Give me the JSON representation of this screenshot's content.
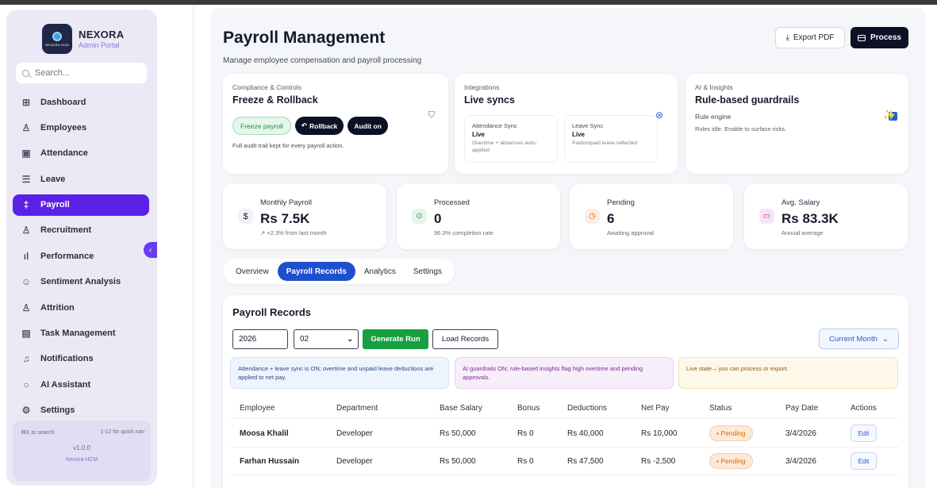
{
  "brand": {
    "name": "NEXORA",
    "subtitle": "Admin Portal",
    "logo_text": "NEXORA HCM"
  },
  "search": {
    "placeholder": "Search..."
  },
  "nav": [
    {
      "label": "Dashboard",
      "icon": "grid-icon"
    },
    {
      "label": "Employees",
      "icon": "user-icon"
    },
    {
      "label": "Attendance",
      "icon": "calendar-icon"
    },
    {
      "label": "Leave",
      "icon": "inbox-icon"
    },
    {
      "label": "Payroll",
      "icon": "dollar-icon",
      "active": true
    },
    {
      "label": "Recruitment",
      "icon": "user-icon"
    },
    {
      "label": "Performance",
      "icon": "bar-chart-icon"
    },
    {
      "label": "Sentiment Analysis",
      "icon": "smile-icon"
    },
    {
      "label": "Attrition",
      "icon": "users-icon"
    },
    {
      "label": "Task Management",
      "icon": "clipboard-icon"
    },
    {
      "label": "Notifications",
      "icon": "bell-icon"
    },
    {
      "label": "AI Assistant",
      "icon": "chat-icon"
    },
    {
      "label": "Settings",
      "icon": "gear-icon"
    }
  ],
  "sidebar_footer": {
    "shortcut_search": "⌘K to search",
    "shortcut_nav": "1-12 for quick nav",
    "version": "v1.0.0",
    "product": "Nexora HCM"
  },
  "header": {
    "title": "Payroll Management",
    "subtitle": "Manage employee compensation and payroll processing",
    "export_label": "Export PDF",
    "process_label": "Process"
  },
  "compliance": {
    "eyebrow": "Compliance & Controls",
    "title": "Freeze & Rollback",
    "freeze_label": "Freeze payroll",
    "rollback_label": "Rollback",
    "audit_label": "Audit on",
    "note": "Full audit trail kept for every payroll action."
  },
  "integrations": {
    "eyebrow": "Integrations",
    "title": "Live syncs",
    "attendance": {
      "title": "Attendance Sync",
      "status": "Live",
      "desc": "Overtime + absences auto-applied"
    },
    "leave": {
      "title": "Leave Sync",
      "status": "Live",
      "desc": "Paid/unpaid leave reflected"
    }
  },
  "ai": {
    "eyebrow": "AI & Insights",
    "title": "Rule-based guardrails",
    "rule_label": "Rule engine",
    "rule_checked": true,
    "note": "Rules idle. Enable to surface risks."
  },
  "stats": [
    {
      "label": "Monthly Payroll",
      "value": "Rs 7.5K",
      "sub": "↗ +2.3% from last month",
      "icon": "dollar-icon"
    },
    {
      "label": "Processed",
      "value": "0",
      "sub": "96.3% completion rate",
      "icon": "check-circle-icon"
    },
    {
      "label": "Pending",
      "value": "6",
      "sub": "Awaiting approval",
      "icon": "clock-icon"
    },
    {
      "label": "Avg. Salary",
      "value": "Rs 83.3K",
      "sub": "Annual average",
      "icon": "card-icon"
    }
  ],
  "tabs": [
    "Overview",
    "Payroll Records",
    "Analytics",
    "Settings"
  ],
  "records": {
    "title": "Payroll Records",
    "year_value": "2026",
    "month_value": "02",
    "generate_label": "Generate Run",
    "load_label": "Load Records",
    "period_label": "Current Month",
    "notes": [
      "Attendance + leave sync is ON; overtime and unpaid leave deductions are applied to net pay.",
      "AI guardrails ON; rule-based insights flag high overtime and pending approvals.",
      "Live state – you can process or export."
    ],
    "columns": [
      "Employee",
      "Department",
      "Base Salary",
      "Bonus",
      "Deductions",
      "Net Pay",
      "Status",
      "Pay Date",
      "Actions"
    ],
    "rows": [
      {
        "employee": "Moosa Khalil",
        "department": "Developer",
        "base": "Rs 50,000",
        "bonus": "Rs 0",
        "deductions": "Rs 40,000",
        "net": "Rs 10,000",
        "status": "• Pending",
        "date": "3/4/2026",
        "action": "Edit"
      },
      {
        "employee": "Farhan Hussain",
        "department": "Developer",
        "base": "Rs 50,000",
        "bonus": "Rs 0",
        "deductions": "Rs 47,500",
        "net": "Rs -2,500",
        "status": "• Pending",
        "date": "3/4/2026",
        "action": "Edit"
      }
    ]
  }
}
